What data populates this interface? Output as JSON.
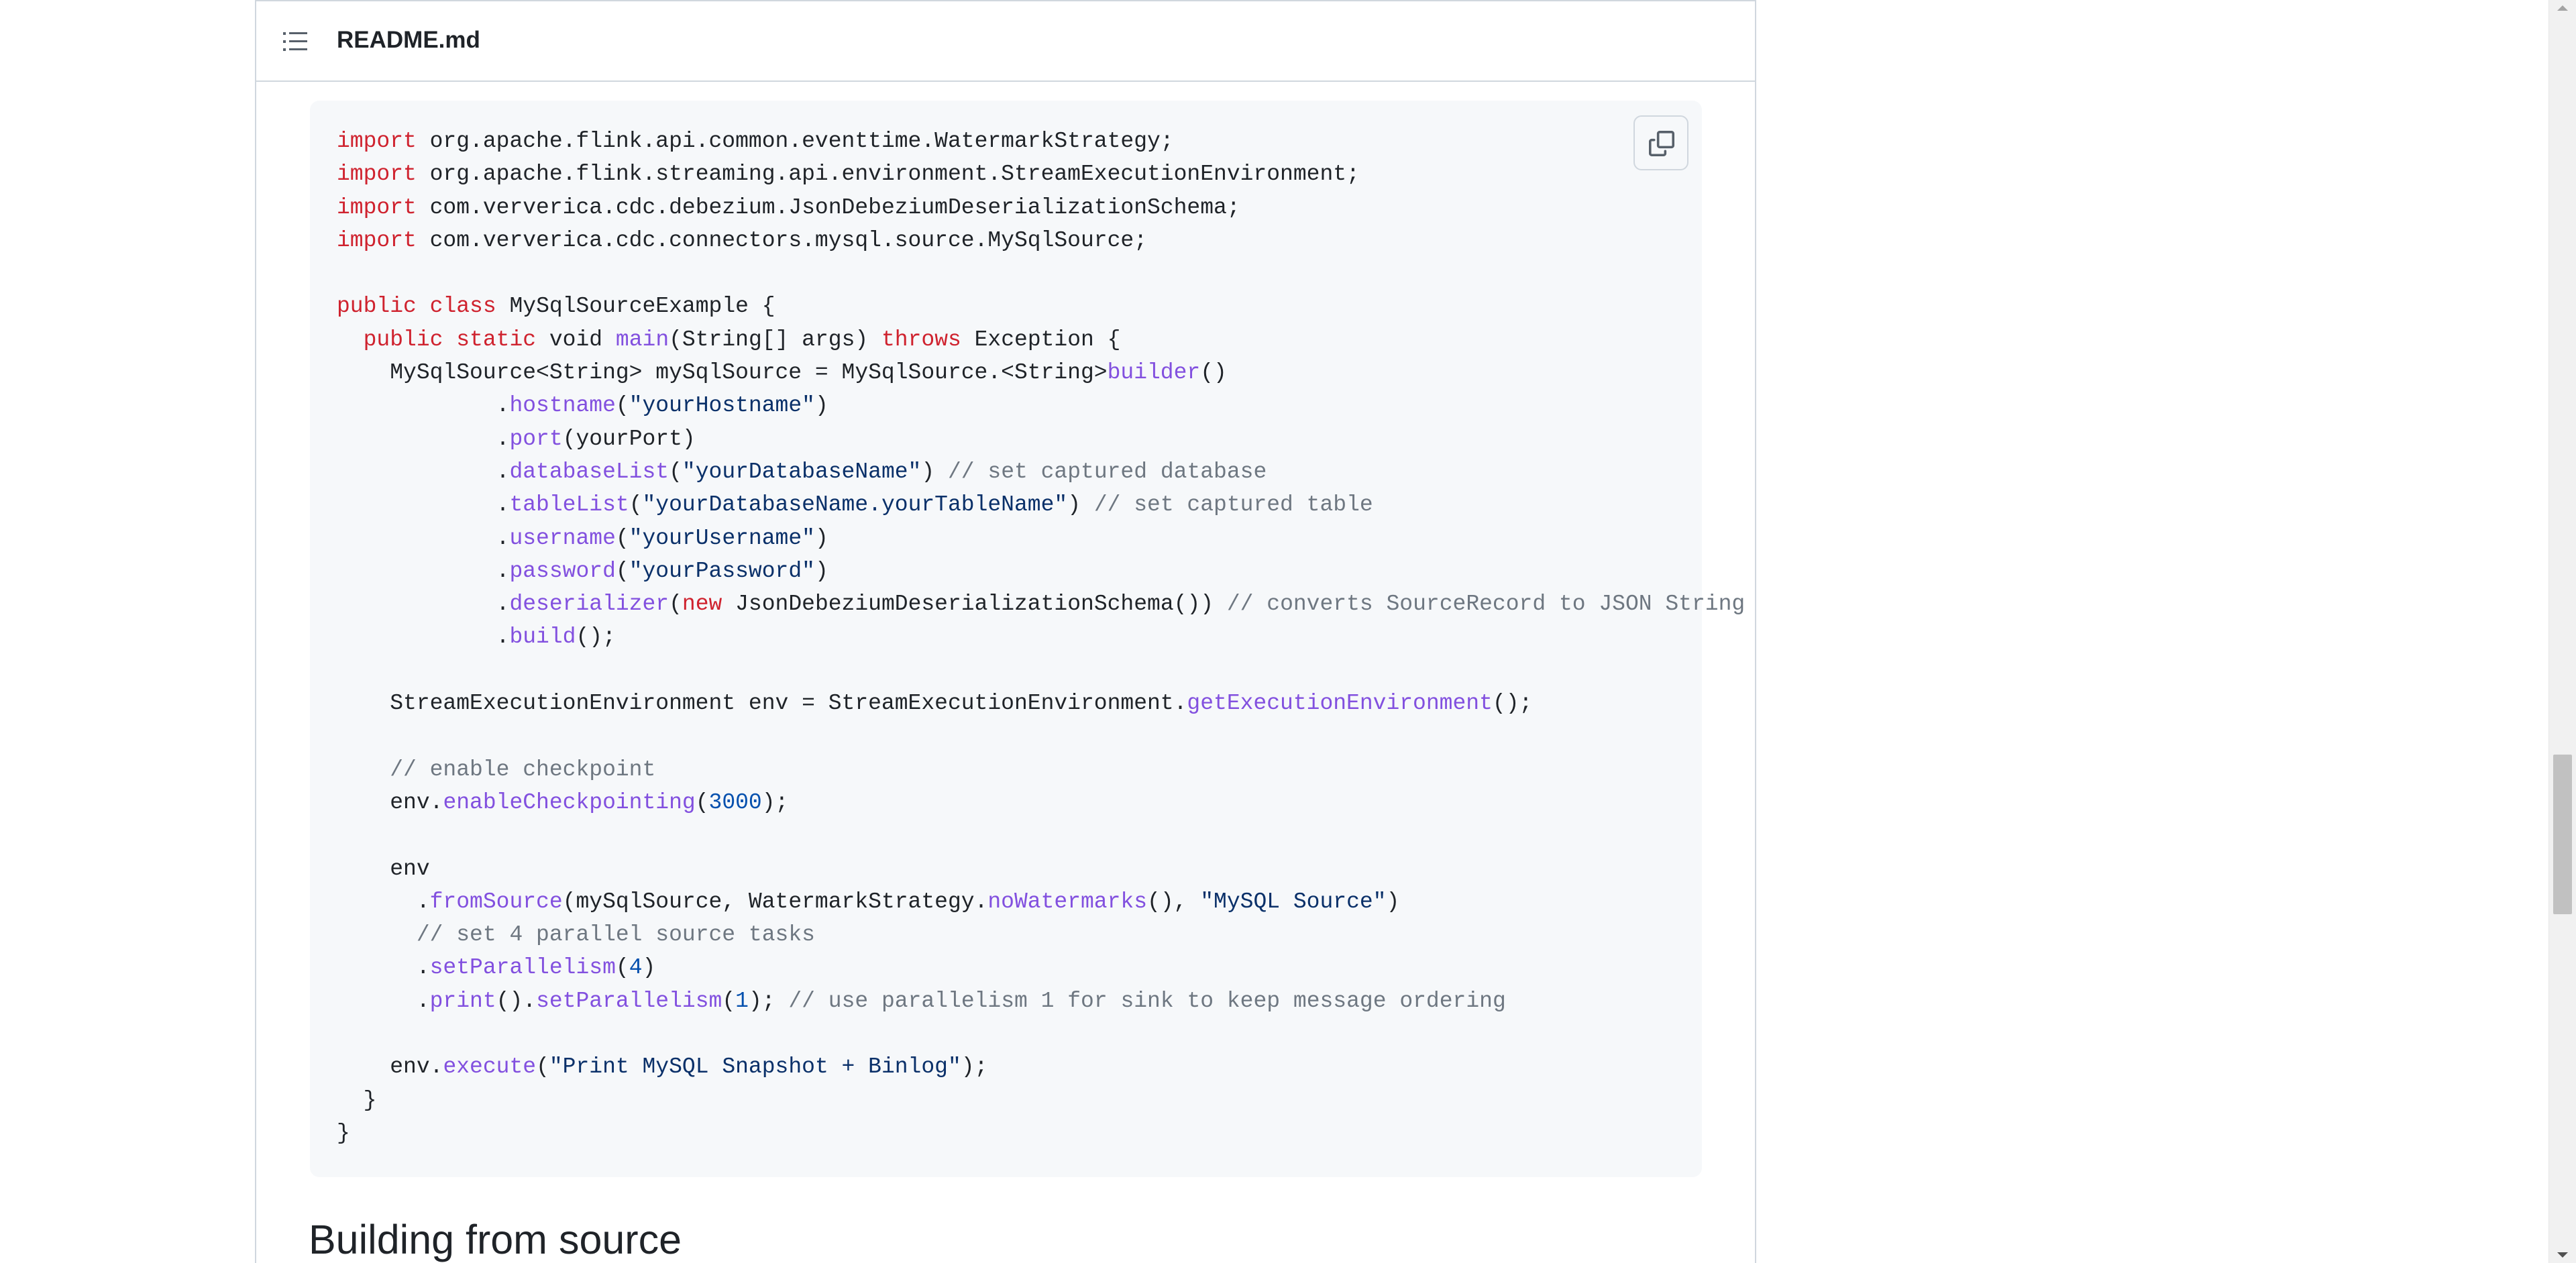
{
  "readme": {
    "title": "README.md",
    "toc_icon": "list-icon"
  },
  "code": {
    "copy_icon": "copy-icon",
    "lines": [
      [
        {
          "t": "kw",
          "s": "import"
        },
        {
          "t": "p",
          "s": " org.apache.flink.api.common.eventtime.WatermarkStrategy;"
        }
      ],
      [
        {
          "t": "kw",
          "s": "import"
        },
        {
          "t": "p",
          "s": " org.apache.flink.streaming.api.environment.StreamExecutionEnvironment;"
        }
      ],
      [
        {
          "t": "kw",
          "s": "import"
        },
        {
          "t": "p",
          "s": " com.ververica.cdc.debezium.JsonDebeziumDeserializationSchema;"
        }
      ],
      [
        {
          "t": "kw",
          "s": "import"
        },
        {
          "t": "p",
          "s": " com.ververica.cdc.connectors.mysql.source.MySqlSource;"
        }
      ],
      [],
      [
        {
          "t": "kw",
          "s": "public"
        },
        {
          "t": "p",
          "s": " "
        },
        {
          "t": "kw",
          "s": "class"
        },
        {
          "t": "p",
          "s": " MySqlSourceExample {"
        }
      ],
      [
        {
          "t": "p",
          "s": "  "
        },
        {
          "t": "kw",
          "s": "public"
        },
        {
          "t": "p",
          "s": " "
        },
        {
          "t": "kw",
          "s": "static"
        },
        {
          "t": "p",
          "s": " void "
        },
        {
          "t": "fn",
          "s": "main"
        },
        {
          "t": "p",
          "s": "(String[] args) "
        },
        {
          "t": "kw",
          "s": "throws"
        },
        {
          "t": "p",
          "s": " Exception {"
        }
      ],
      [
        {
          "t": "p",
          "s": "    MySqlSource<String> mySqlSource = MySqlSource.<String>"
        },
        {
          "t": "fn",
          "s": "builder"
        },
        {
          "t": "p",
          "s": "()"
        }
      ],
      [
        {
          "t": "p",
          "s": "            ."
        },
        {
          "t": "fn",
          "s": "hostname"
        },
        {
          "t": "p",
          "s": "("
        },
        {
          "t": "str",
          "s": "\"yourHostname\""
        },
        {
          "t": "p",
          "s": ")"
        }
      ],
      [
        {
          "t": "p",
          "s": "            ."
        },
        {
          "t": "fn",
          "s": "port"
        },
        {
          "t": "p",
          "s": "(yourPort)"
        }
      ],
      [
        {
          "t": "p",
          "s": "            ."
        },
        {
          "t": "fn",
          "s": "databaseList"
        },
        {
          "t": "p",
          "s": "("
        },
        {
          "t": "str",
          "s": "\"yourDatabaseName\""
        },
        {
          "t": "p",
          "s": ") "
        },
        {
          "t": "cm",
          "s": "// set captured database"
        }
      ],
      [
        {
          "t": "p",
          "s": "            ."
        },
        {
          "t": "fn",
          "s": "tableList"
        },
        {
          "t": "p",
          "s": "("
        },
        {
          "t": "str",
          "s": "\"yourDatabaseName.yourTableName\""
        },
        {
          "t": "p",
          "s": ") "
        },
        {
          "t": "cm",
          "s": "// set captured table"
        }
      ],
      [
        {
          "t": "p",
          "s": "            ."
        },
        {
          "t": "fn",
          "s": "username"
        },
        {
          "t": "p",
          "s": "("
        },
        {
          "t": "str",
          "s": "\"yourUsername\""
        },
        {
          "t": "p",
          "s": ")"
        }
      ],
      [
        {
          "t": "p",
          "s": "            ."
        },
        {
          "t": "fn",
          "s": "password"
        },
        {
          "t": "p",
          "s": "("
        },
        {
          "t": "str",
          "s": "\"yourPassword\""
        },
        {
          "t": "p",
          "s": ")"
        }
      ],
      [
        {
          "t": "p",
          "s": "            ."
        },
        {
          "t": "fn",
          "s": "deserializer"
        },
        {
          "t": "p",
          "s": "("
        },
        {
          "t": "kw",
          "s": "new"
        },
        {
          "t": "p",
          "s": " JsonDebeziumDeserializationSchema()) "
        },
        {
          "t": "cm",
          "s": "// converts SourceRecord to JSON String"
        }
      ],
      [
        {
          "t": "p",
          "s": "            ."
        },
        {
          "t": "fn",
          "s": "build"
        },
        {
          "t": "p",
          "s": "();"
        }
      ],
      [],
      [
        {
          "t": "p",
          "s": "    StreamExecutionEnvironment env = StreamExecutionEnvironment."
        },
        {
          "t": "fn",
          "s": "getExecutionEnvironment"
        },
        {
          "t": "p",
          "s": "();"
        }
      ],
      [],
      [
        {
          "t": "p",
          "s": "    "
        },
        {
          "t": "cm",
          "s": "// enable checkpoint"
        }
      ],
      [
        {
          "t": "p",
          "s": "    env."
        },
        {
          "t": "fn",
          "s": "enableCheckpointing"
        },
        {
          "t": "p",
          "s": "("
        },
        {
          "t": "num",
          "s": "3000"
        },
        {
          "t": "p",
          "s": ");"
        }
      ],
      [],
      [
        {
          "t": "p",
          "s": "    env"
        }
      ],
      [
        {
          "t": "p",
          "s": "      ."
        },
        {
          "t": "fn",
          "s": "fromSource"
        },
        {
          "t": "p",
          "s": "(mySqlSource, WatermarkStrategy."
        },
        {
          "t": "fn",
          "s": "noWatermarks"
        },
        {
          "t": "p",
          "s": "(), "
        },
        {
          "t": "str",
          "s": "\"MySQL Source\""
        },
        {
          "t": "p",
          "s": ")"
        }
      ],
      [
        {
          "t": "p",
          "s": "      "
        },
        {
          "t": "cm",
          "s": "// set 4 parallel source tasks"
        }
      ],
      [
        {
          "t": "p",
          "s": "      ."
        },
        {
          "t": "fn",
          "s": "setParallelism"
        },
        {
          "t": "p",
          "s": "("
        },
        {
          "t": "num",
          "s": "4"
        },
        {
          "t": "p",
          "s": ")"
        }
      ],
      [
        {
          "t": "p",
          "s": "      ."
        },
        {
          "t": "fn",
          "s": "print"
        },
        {
          "t": "p",
          "s": "()."
        },
        {
          "t": "fn",
          "s": "setParallelism"
        },
        {
          "t": "p",
          "s": "("
        },
        {
          "t": "num",
          "s": "1"
        },
        {
          "t": "p",
          "s": "); "
        },
        {
          "t": "cm",
          "s": "// use parallelism 1 for sink to keep message ordering"
        }
      ],
      [],
      [
        {
          "t": "p",
          "s": "    env."
        },
        {
          "t": "fn",
          "s": "execute"
        },
        {
          "t": "p",
          "s": "("
        },
        {
          "t": "str",
          "s": "\"Print MySQL Snapshot + Binlog\""
        },
        {
          "t": "p",
          "s": ");"
        }
      ],
      [
        {
          "t": "p",
          "s": "  }"
        }
      ],
      [
        {
          "t": "p",
          "s": "}"
        }
      ]
    ]
  },
  "next_section": {
    "heading": "Building from source"
  }
}
